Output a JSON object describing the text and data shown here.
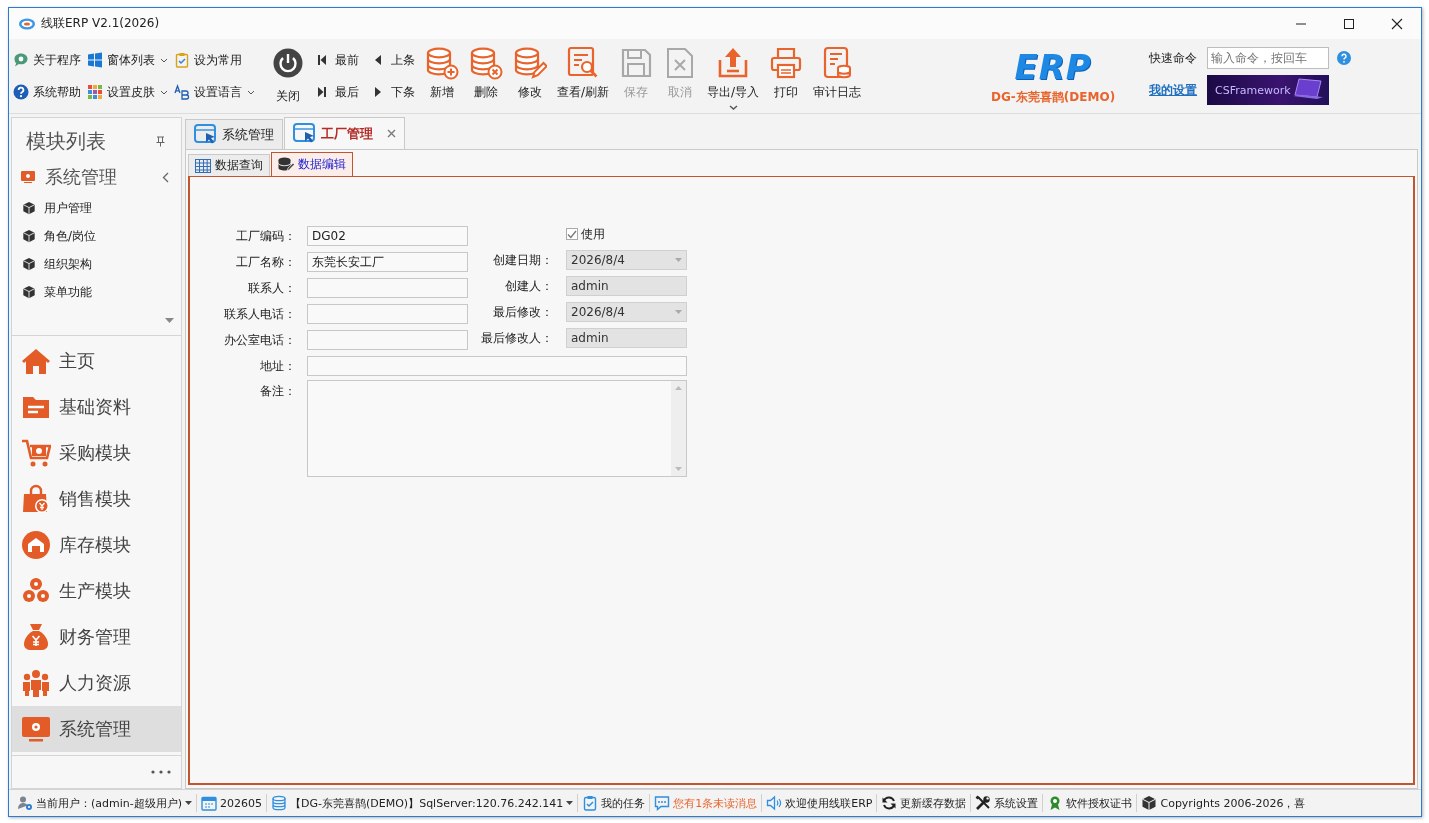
{
  "window": {
    "title": "线联ERP V2.1(2026)"
  },
  "toolbar": {
    "quick": [
      {
        "label": "关于程序",
        "dropdown": false
      },
      {
        "label": "系统帮助",
        "dropdown": false
      },
      {
        "label": "窗体列表",
        "dropdown": true
      },
      {
        "label": "设置皮肤",
        "dropdown": true
      },
      {
        "label": "设为常用",
        "dropdown": false
      },
      {
        "label": "设置语言",
        "dropdown": true
      }
    ],
    "close": {
      "label": "关闭"
    },
    "nav": [
      {
        "label": "最前"
      },
      {
        "label": "上条"
      },
      {
        "label": "最后"
      },
      {
        "label": "下条"
      }
    ],
    "actions": [
      {
        "label": "新增",
        "disabled": false,
        "dropdown": false
      },
      {
        "label": "删除",
        "disabled": false,
        "dropdown": false
      },
      {
        "label": "修改",
        "disabled": false,
        "dropdown": false
      },
      {
        "label": "查看/刷新",
        "disabled": false,
        "dropdown": false
      },
      {
        "label": "保存",
        "disabled": true,
        "dropdown": false
      },
      {
        "label": "取消",
        "disabled": true,
        "dropdown": false
      },
      {
        "label": "导出/导入",
        "disabled": false,
        "dropdown": true
      },
      {
        "label": "打印",
        "disabled": false,
        "dropdown": false
      },
      {
        "label": "审计日志",
        "disabled": false,
        "dropdown": false
      }
    ],
    "logo": {
      "text": "ERP",
      "caption": "DG-东莞喜鹊(DEMO)"
    },
    "quick_command": {
      "label": "快速命令",
      "placeholder": "输入命令，按回车"
    },
    "my_settings": "我的设置",
    "banner": "CSFramework"
  },
  "sidebar": {
    "title": "模块列表",
    "group": {
      "label": "系统管理",
      "expanded": true,
      "items": [
        "用户管理",
        "角色/岗位",
        "组织架构",
        "菜单功能"
      ]
    },
    "modules": [
      {
        "label": "主页",
        "selected": false
      },
      {
        "label": "基础资料",
        "selected": false
      },
      {
        "label": "采购模块",
        "selected": false
      },
      {
        "label": "销售模块",
        "selected": false
      },
      {
        "label": "库存模块",
        "selected": false
      },
      {
        "label": "生产模块",
        "selected": false
      },
      {
        "label": "财务管理",
        "selected": false
      },
      {
        "label": "人力资源",
        "selected": false
      },
      {
        "label": "系统管理",
        "selected": true
      }
    ]
  },
  "tabs": [
    {
      "label": "系统管理",
      "selected": false,
      "closable": false
    },
    {
      "label": "工厂管理",
      "selected": true,
      "closable": true
    }
  ],
  "subtabs": [
    {
      "label": "数据查询",
      "selected": false
    },
    {
      "label": "数据编辑",
      "selected": true
    }
  ],
  "form": {
    "fields": [
      {
        "label": "工厂编码：",
        "value": "DG02"
      },
      {
        "label": "工厂名称：",
        "value": "东莞长安工厂"
      },
      {
        "label": "联系人："
      },
      {
        "label": "联系人电话："
      },
      {
        "label": "办公室电话："
      }
    ],
    "enabled": {
      "label": "使用",
      "checked": true
    },
    "meta": [
      {
        "label": "创建日期：",
        "value": "2026/8/4",
        "kind": "date"
      },
      {
        "label": "创建人：",
        "value": "admin",
        "kind": "text"
      },
      {
        "label": "最后修改：",
        "value": "2026/8/4",
        "kind": "date"
      },
      {
        "label": "最后修改人：",
        "value": "admin",
        "kind": "text"
      }
    ],
    "address": {
      "label": "地址："
    },
    "remark": {
      "label": "备注："
    }
  },
  "status_bar": [
    {
      "text": "当前用户：(admin-超级用户)",
      "dropdown": true,
      "highlight": false
    },
    {
      "text": "202605",
      "dropdown": false,
      "highlight": false
    },
    {
      "text": "【DG-东莞喜鹊(DEMO)】SqlServer:120.76.242.141",
      "dropdown": true,
      "highlight": false
    },
    {
      "text": "我的任务",
      "dropdown": false,
      "highlight": false
    },
    {
      "text": "您有1条未读消息",
      "dropdown": false,
      "highlight": true
    },
    {
      "text": "欢迎使用线联ERP",
      "dropdown": false,
      "highlight": false
    },
    {
      "text": "更新缓存数据",
      "dropdown": false,
      "highlight": false
    },
    {
      "text": "系统设置",
      "dropdown": false,
      "highlight": false
    },
    {
      "text": "软件授权证书",
      "dropdown": false,
      "highlight": false
    },
    {
      "text": "Copyrights 2006-2026，喜",
      "dropdown": false,
      "highlight": false
    }
  ]
}
